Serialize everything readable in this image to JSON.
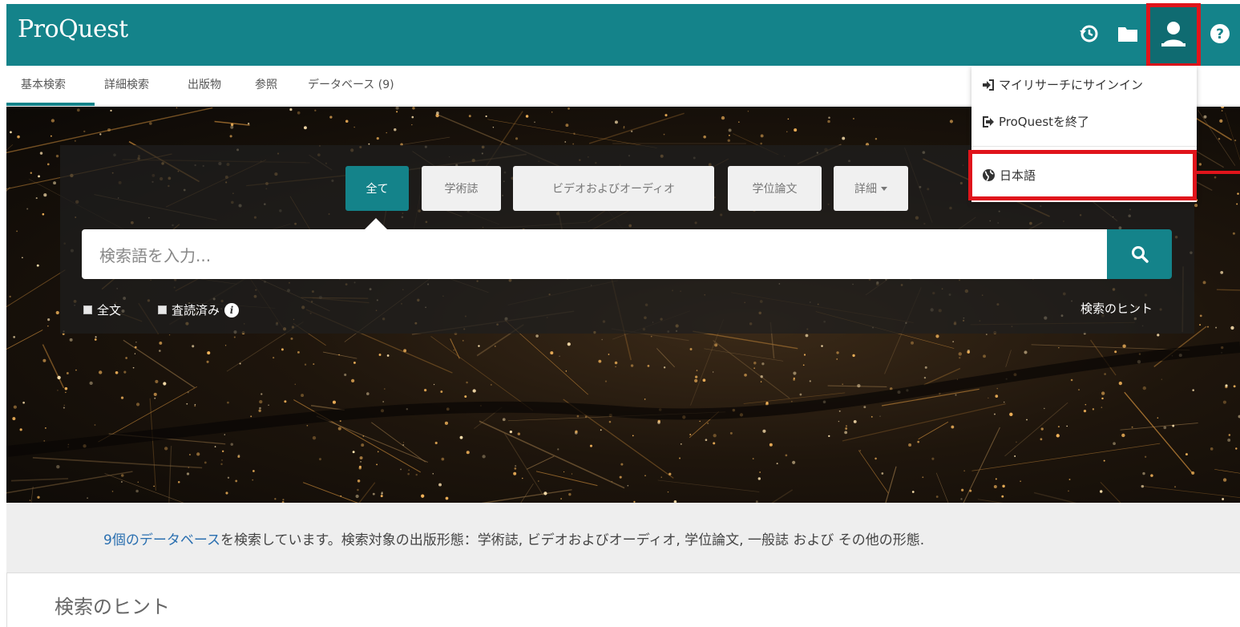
{
  "header": {
    "brand": "ProQuest",
    "icons": [
      "history-icon",
      "folder-icon",
      "user-icon",
      "help-icon"
    ],
    "accent_color": "#14838a",
    "highlight_color": "#e0141b"
  },
  "nav": {
    "items": [
      {
        "label": "基本検索",
        "active": true
      },
      {
        "label": "詳細検索"
      },
      {
        "label": "出版物"
      },
      {
        "label": "参照"
      },
      {
        "label": "データベース (9)"
      }
    ]
  },
  "search": {
    "tabs": [
      {
        "label": "全て",
        "active": true
      },
      {
        "label": "学術誌"
      },
      {
        "label": "ビデオおよびオーディオ"
      },
      {
        "label": "学位論文"
      },
      {
        "label": "詳細"
      }
    ],
    "placeholder": "検索語を入力...",
    "checkboxes": [
      {
        "label": "全文",
        "checked": false
      },
      {
        "label": "査読済み",
        "checked": false
      }
    ],
    "tips_link": "検索のヒント"
  },
  "user_menu": {
    "items": [
      {
        "label": "マイリサーチにサインイン",
        "icon": "sign-in-icon"
      },
      {
        "label": "ProQuestを終了",
        "icon": "sign-out-icon"
      },
      {
        "label": "日本語",
        "icon": "globe-icon"
      }
    ]
  },
  "info": {
    "link_text": "9個のデータベース",
    "text": "を検索しています。検索対象の出版形態：学術誌, ビデオおよびオーディオ, 学位論文, 一般誌 および その他の形態."
  },
  "tips_heading": "検索のヒント"
}
